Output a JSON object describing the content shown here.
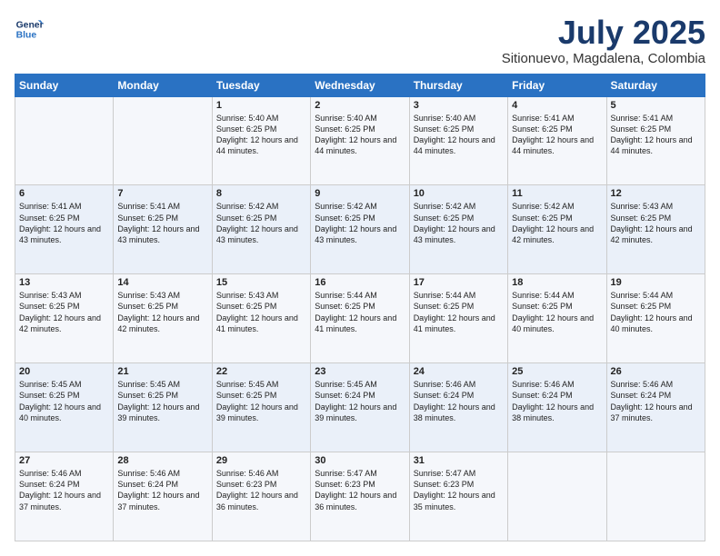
{
  "logo": {
    "line1": "General",
    "line2": "Blue"
  },
  "title": "July 2025",
  "subtitle": "Sitionuevo, Magdalena, Colombia",
  "header": {
    "days": [
      "Sunday",
      "Monday",
      "Tuesday",
      "Wednesday",
      "Thursday",
      "Friday",
      "Saturday"
    ]
  },
  "weeks": [
    [
      {
        "day": "",
        "info": ""
      },
      {
        "day": "",
        "info": ""
      },
      {
        "day": "1",
        "info": "Sunrise: 5:40 AM\nSunset: 6:25 PM\nDaylight: 12 hours and 44 minutes."
      },
      {
        "day": "2",
        "info": "Sunrise: 5:40 AM\nSunset: 6:25 PM\nDaylight: 12 hours and 44 minutes."
      },
      {
        "day": "3",
        "info": "Sunrise: 5:40 AM\nSunset: 6:25 PM\nDaylight: 12 hours and 44 minutes."
      },
      {
        "day": "4",
        "info": "Sunrise: 5:41 AM\nSunset: 6:25 PM\nDaylight: 12 hours and 44 minutes."
      },
      {
        "day": "5",
        "info": "Sunrise: 5:41 AM\nSunset: 6:25 PM\nDaylight: 12 hours and 44 minutes."
      }
    ],
    [
      {
        "day": "6",
        "info": "Sunrise: 5:41 AM\nSunset: 6:25 PM\nDaylight: 12 hours and 43 minutes."
      },
      {
        "day": "7",
        "info": "Sunrise: 5:41 AM\nSunset: 6:25 PM\nDaylight: 12 hours and 43 minutes."
      },
      {
        "day": "8",
        "info": "Sunrise: 5:42 AM\nSunset: 6:25 PM\nDaylight: 12 hours and 43 minutes."
      },
      {
        "day": "9",
        "info": "Sunrise: 5:42 AM\nSunset: 6:25 PM\nDaylight: 12 hours and 43 minutes."
      },
      {
        "day": "10",
        "info": "Sunrise: 5:42 AM\nSunset: 6:25 PM\nDaylight: 12 hours and 43 minutes."
      },
      {
        "day": "11",
        "info": "Sunrise: 5:42 AM\nSunset: 6:25 PM\nDaylight: 12 hours and 42 minutes."
      },
      {
        "day": "12",
        "info": "Sunrise: 5:43 AM\nSunset: 6:25 PM\nDaylight: 12 hours and 42 minutes."
      }
    ],
    [
      {
        "day": "13",
        "info": "Sunrise: 5:43 AM\nSunset: 6:25 PM\nDaylight: 12 hours and 42 minutes."
      },
      {
        "day": "14",
        "info": "Sunrise: 5:43 AM\nSunset: 6:25 PM\nDaylight: 12 hours and 42 minutes."
      },
      {
        "day": "15",
        "info": "Sunrise: 5:43 AM\nSunset: 6:25 PM\nDaylight: 12 hours and 41 minutes."
      },
      {
        "day": "16",
        "info": "Sunrise: 5:44 AM\nSunset: 6:25 PM\nDaylight: 12 hours and 41 minutes."
      },
      {
        "day": "17",
        "info": "Sunrise: 5:44 AM\nSunset: 6:25 PM\nDaylight: 12 hours and 41 minutes."
      },
      {
        "day": "18",
        "info": "Sunrise: 5:44 AM\nSunset: 6:25 PM\nDaylight: 12 hours and 40 minutes."
      },
      {
        "day": "19",
        "info": "Sunrise: 5:44 AM\nSunset: 6:25 PM\nDaylight: 12 hours and 40 minutes."
      }
    ],
    [
      {
        "day": "20",
        "info": "Sunrise: 5:45 AM\nSunset: 6:25 PM\nDaylight: 12 hours and 40 minutes."
      },
      {
        "day": "21",
        "info": "Sunrise: 5:45 AM\nSunset: 6:25 PM\nDaylight: 12 hours and 39 minutes."
      },
      {
        "day": "22",
        "info": "Sunrise: 5:45 AM\nSunset: 6:25 PM\nDaylight: 12 hours and 39 minutes."
      },
      {
        "day": "23",
        "info": "Sunrise: 5:45 AM\nSunset: 6:24 PM\nDaylight: 12 hours and 39 minutes."
      },
      {
        "day": "24",
        "info": "Sunrise: 5:46 AM\nSunset: 6:24 PM\nDaylight: 12 hours and 38 minutes."
      },
      {
        "day": "25",
        "info": "Sunrise: 5:46 AM\nSunset: 6:24 PM\nDaylight: 12 hours and 38 minutes."
      },
      {
        "day": "26",
        "info": "Sunrise: 5:46 AM\nSunset: 6:24 PM\nDaylight: 12 hours and 37 minutes."
      }
    ],
    [
      {
        "day": "27",
        "info": "Sunrise: 5:46 AM\nSunset: 6:24 PM\nDaylight: 12 hours and 37 minutes."
      },
      {
        "day": "28",
        "info": "Sunrise: 5:46 AM\nSunset: 6:24 PM\nDaylight: 12 hours and 37 minutes."
      },
      {
        "day": "29",
        "info": "Sunrise: 5:46 AM\nSunset: 6:23 PM\nDaylight: 12 hours and 36 minutes."
      },
      {
        "day": "30",
        "info": "Sunrise: 5:47 AM\nSunset: 6:23 PM\nDaylight: 12 hours and 36 minutes."
      },
      {
        "day": "31",
        "info": "Sunrise: 5:47 AM\nSunset: 6:23 PM\nDaylight: 12 hours and 35 minutes."
      },
      {
        "day": "",
        "info": ""
      },
      {
        "day": "",
        "info": ""
      }
    ]
  ]
}
